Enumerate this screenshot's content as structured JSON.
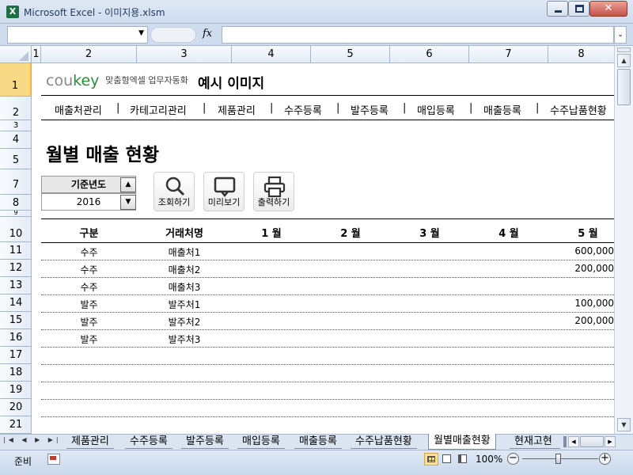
{
  "window": {
    "app_icon": "excel-icon",
    "title": "Microsoft Excel - 이미지용.xlsm"
  },
  "formula_bar": {
    "name_box_value": "",
    "fx_label": "fx",
    "formula_value": ""
  },
  "columns": [
    "1",
    "2",
    "3",
    "4",
    "5",
    "6",
    "7",
    "8"
  ],
  "rows": [
    "1",
    "2",
    "3",
    "4",
    "5",
    "7",
    "8",
    "9",
    "10",
    "11",
    "12",
    "13",
    "14",
    "15",
    "16",
    "17",
    "18",
    "19",
    "20",
    "21"
  ],
  "sheet": {
    "logo_cou": "cou",
    "logo_key": "key",
    "logo_tagline": "맞춤형엑셀 업무자동화",
    "header_title": "예시 이미지",
    "nav": [
      "매출처관리",
      "카테고리관리",
      "제품관리",
      "수주등록",
      "발주등록",
      "매입등록",
      "매출등록",
      "수주납품현황"
    ],
    "page_title": "월별 매출 현황",
    "year_label": "기준년도",
    "year_value": "2016",
    "buttons": {
      "search": "조회하기",
      "preview": "미리보기",
      "print": "출력하기"
    },
    "table": {
      "headers": [
        "구분",
        "거래처명",
        "1 월",
        "2 월",
        "3 월",
        "4 월",
        "5 월"
      ],
      "rows": [
        {
          "type": "수주",
          "name": "매출처1",
          "m5": "600,000"
        },
        {
          "type": "수주",
          "name": "매출처2",
          "m5": "200,000"
        },
        {
          "type": "수주",
          "name": "매출처3",
          "m5": ""
        },
        {
          "type": "발주",
          "name": "발주처1",
          "m5": "100,000"
        },
        {
          "type": "발주",
          "name": "발주처2",
          "m5": "200,000"
        },
        {
          "type": "발주",
          "name": "발주처3",
          "m5": ""
        }
      ]
    }
  },
  "sheet_tabs": [
    "제품관리",
    "수주등록",
    "발주등록",
    "매입등록",
    "매출등록",
    "수주납품현황",
    "월별매출현황",
    "현재고현"
  ],
  "active_tab": "월별매출현황",
  "status": {
    "ready": "준비",
    "zoom": "100%"
  },
  "colors": {
    "logo_cou": "#888888",
    "logo_key": "#2e8b3a",
    "selected_row": "#f8d985"
  }
}
